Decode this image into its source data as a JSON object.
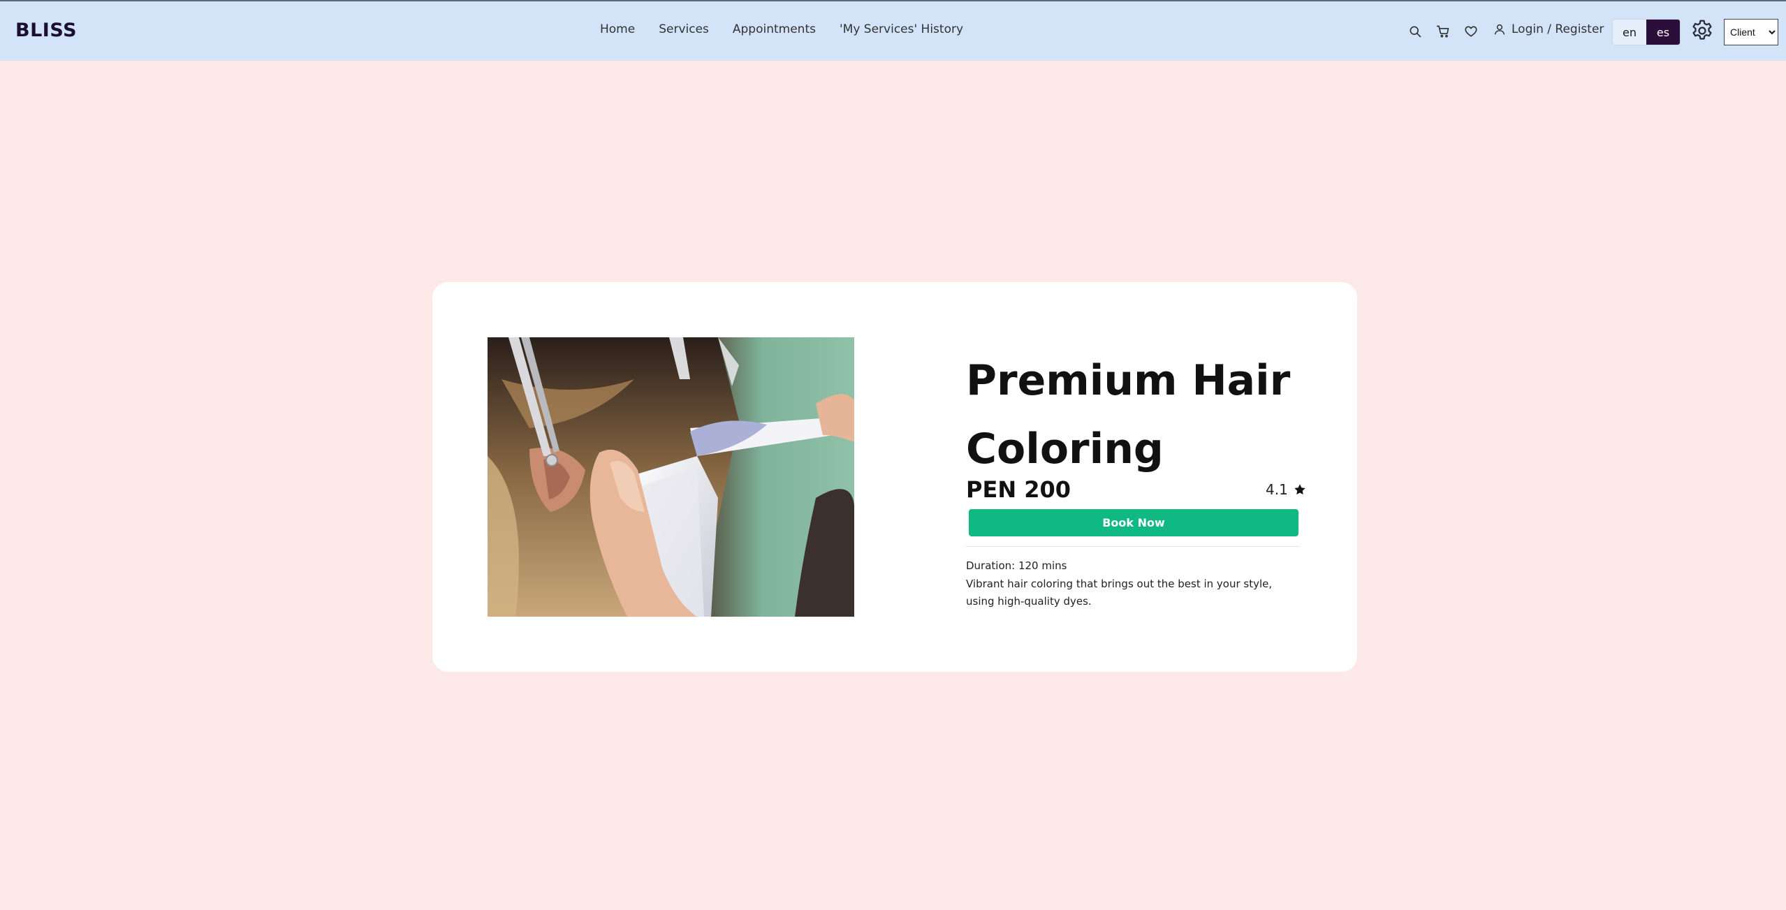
{
  "header": {
    "brand": "BLISS",
    "nav": [
      "Home",
      "Services",
      "Appointments",
      "'My Services' History"
    ],
    "login_label": "Login / Register",
    "languages": [
      {
        "code": "en",
        "active": false
      },
      {
        "code": "es",
        "active": true
      }
    ],
    "role_select": {
      "selected": "Client"
    },
    "icons": [
      "search-icon",
      "cart-icon",
      "heart-icon",
      "user-icon",
      "gear-icon"
    ]
  },
  "service": {
    "title": "Premium Hair Coloring",
    "price": "PEN 200",
    "rating": "4.1",
    "book_label": "Book Now",
    "duration": "Duration: 120 mins",
    "description": "Vibrant hair coloring that brings out the best in your style, using high-quality dyes."
  },
  "colors": {
    "header_bg": "#d3e3f8",
    "page_bg": "#fde8e8",
    "book_button": "#10b981",
    "active_lang": "#2b0e3a"
  }
}
